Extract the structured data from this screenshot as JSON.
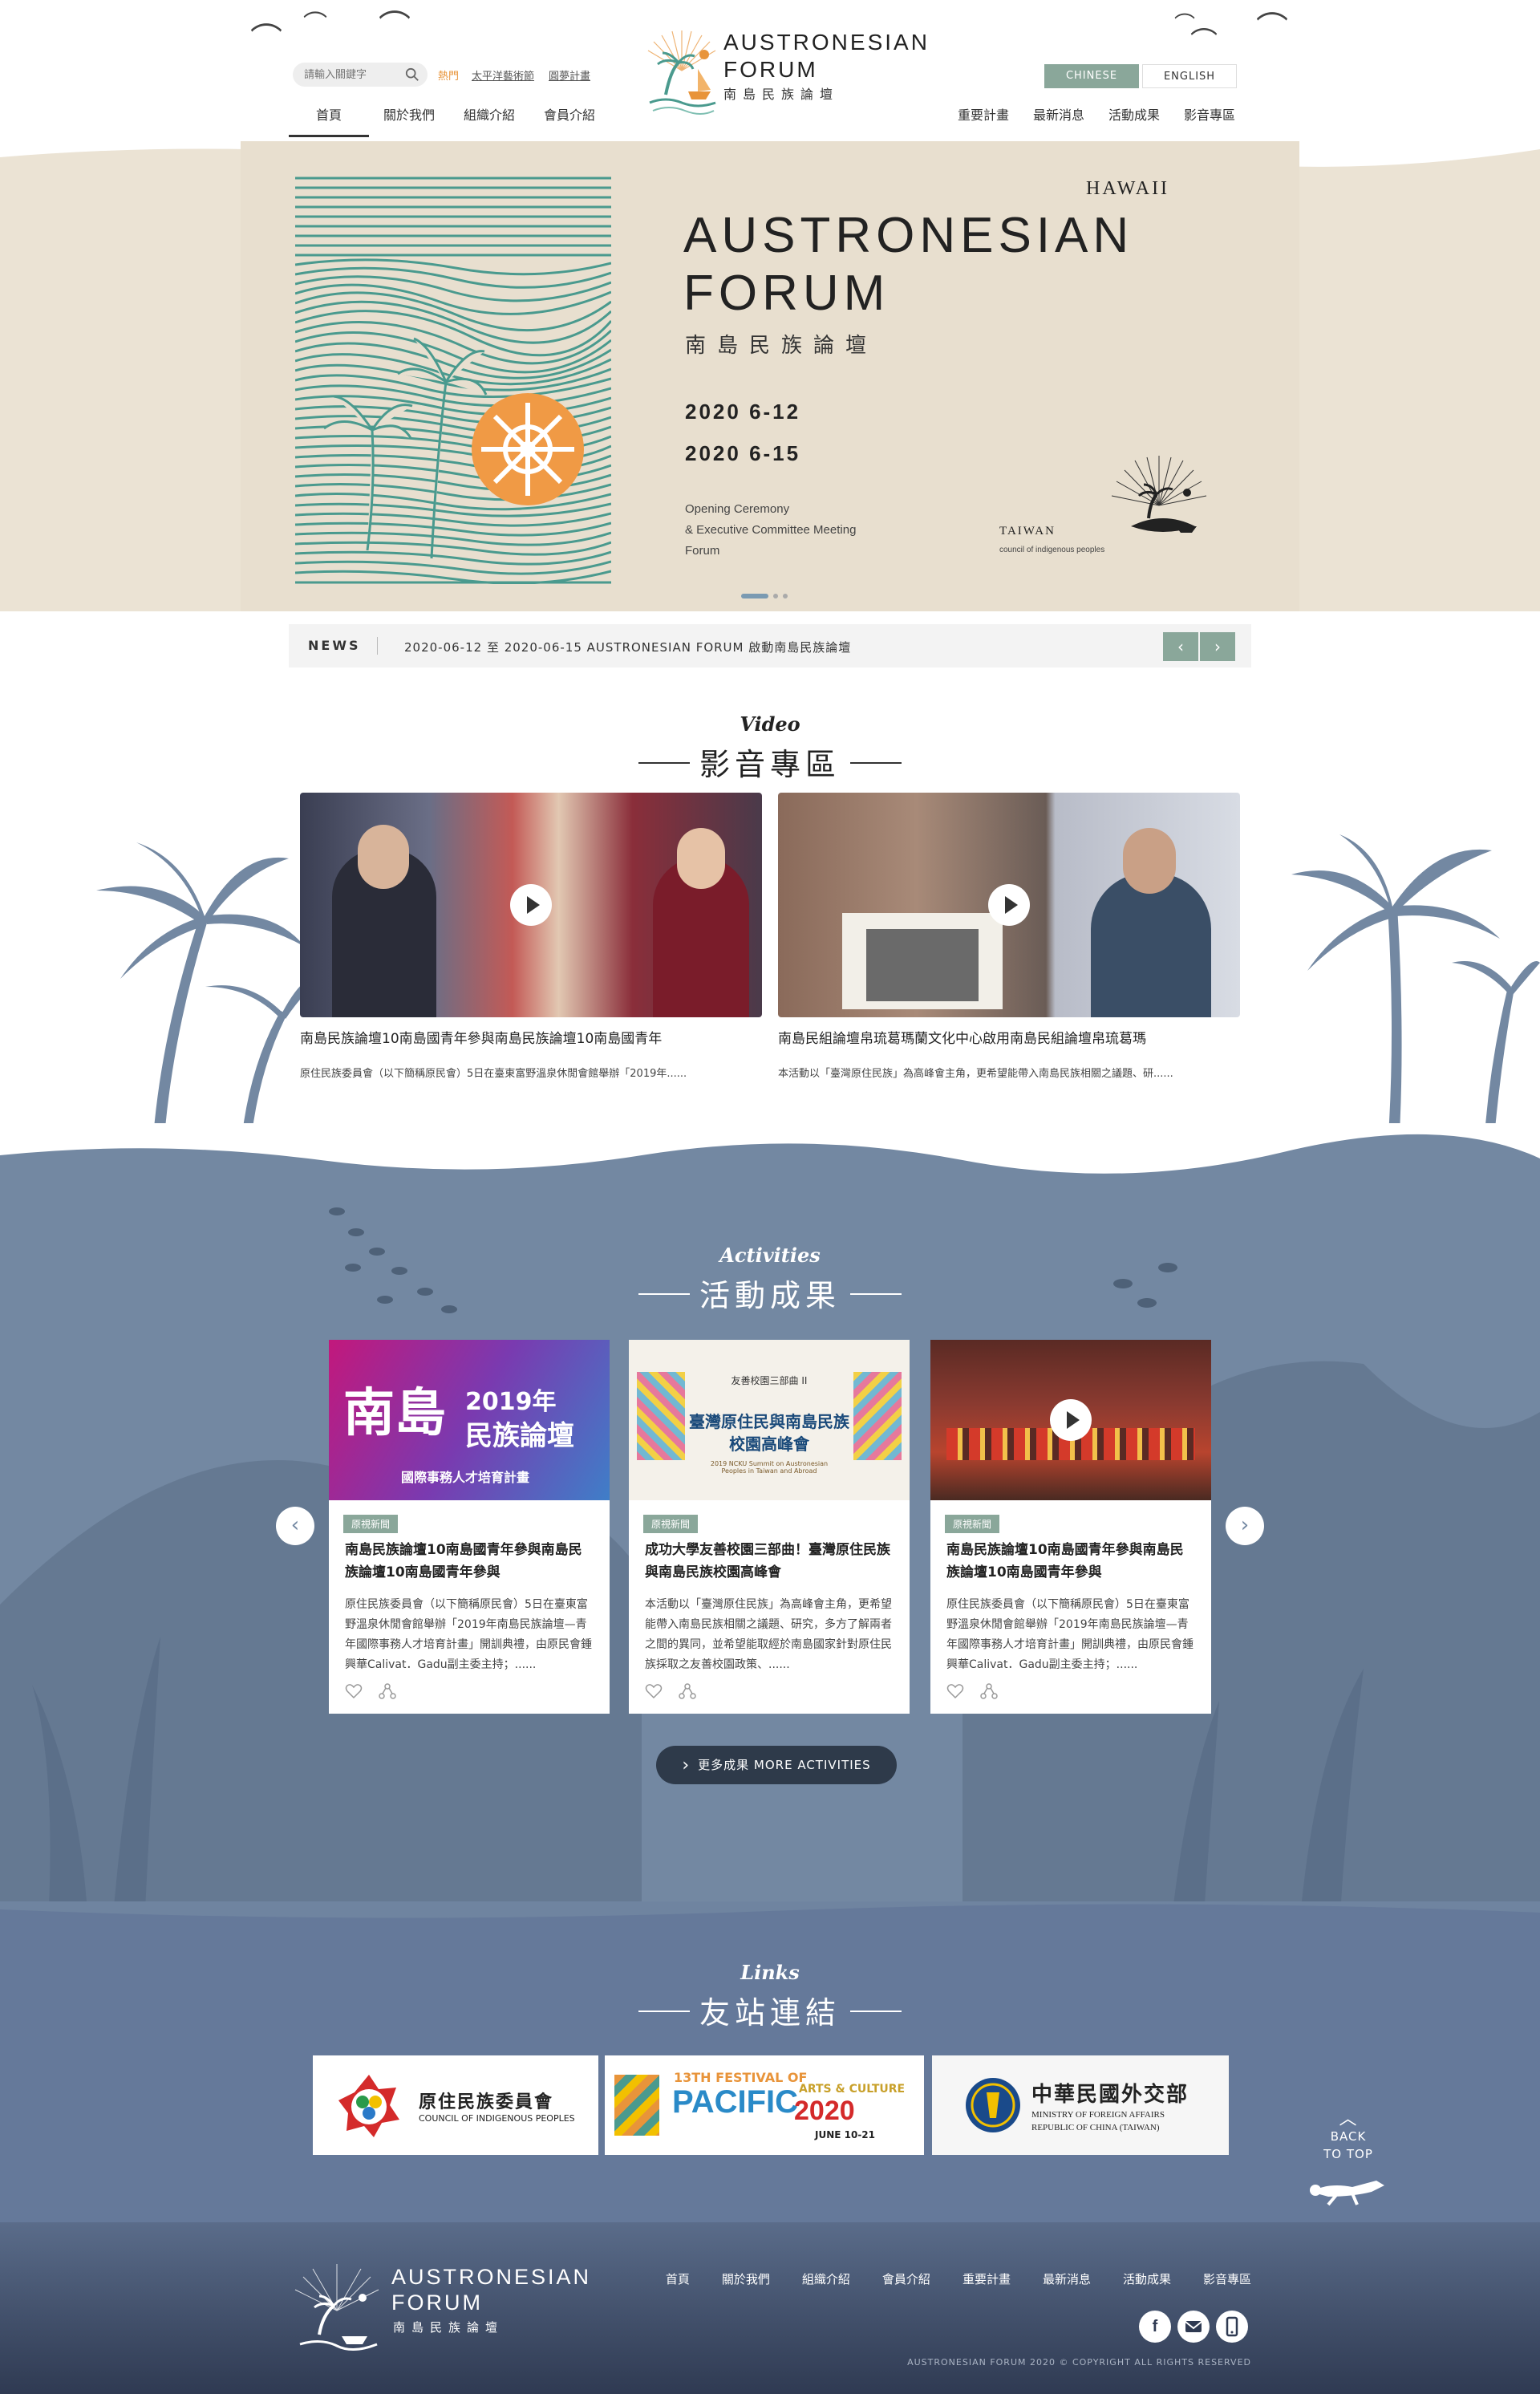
{
  "header": {
    "search_placeholder": "請輸入關鍵字",
    "hot_label": "熱門",
    "hot_links": [
      "太平洋藝術節",
      "圓夢計畫"
    ],
    "nav_left": [
      "首頁",
      "關於我們",
      "組織介紹",
      "會員介紹"
    ],
    "nav_right": [
      "重要計畫",
      "最新消息",
      "活動成果",
      "影音專區"
    ],
    "logo_title_line1": "AUSTRONESIAN",
    "logo_title_line2": "FORUM",
    "logo_sub": "南島民族論壇",
    "lang_chinese": "CHINESE",
    "lang_english": "ENGLISH"
  },
  "banner": {
    "location": "HAWAII",
    "title_line1": "AUSTRONESIAN",
    "title_line2": "FORUM",
    "subtitle": "南島民族論壇",
    "date1": "2020  6-12",
    "date2": "2020  6-15",
    "desc_line1": "Opening Ceremony",
    "desc_line2": "& Executive Committee Meeting",
    "desc_line3": "Forum",
    "taiwan": "TAIWAN",
    "council": "council of indigenous peoples"
  },
  "news": {
    "label": "NEWS",
    "text": "2020-06-12 至 2020-06-15 AUSTRONESIAN FORUM 啟動南島民族論壇",
    "prev": "‹",
    "next": "›"
  },
  "video": {
    "title_en": "Video",
    "title_zh": "影音專區",
    "items": [
      {
        "title": "南島民族論壇10南島國青年參與南島民族論壇10南島國青年",
        "desc": "原住民族委員會（以下簡稱原民會）5日在臺東富野溫泉休閒會館舉辦「2019年......"
      },
      {
        "title": "南島民組論壇帛琉葛瑪蘭文化中心啟用南島民組論壇帛琉葛瑪",
        "desc": "本活動以「臺灣原住民族」為高峰會主角，更希望能帶入南島民族相關之議題、研......"
      }
    ]
  },
  "activities": {
    "title_en": "Activities",
    "title_zh": "活動成果",
    "prev": "‹",
    "next": "›",
    "more_label": "更多成果  MORE ACTIVITIES",
    "items": [
      {
        "tag": "原視新聞",
        "thumb_line1": "南島",
        "thumb_line2": "2019年",
        "thumb_line3": "民族論壇",
        "thumb_line4": "國際事務人才培育計畫",
        "title": "南島民族論壇10南島國青年參與南島民族論壇10南島國青年參與",
        "desc": "原住民族委員會（以下簡稱原民會）5日在臺東富野溫泉休閒會館舉辦「2019年南島民族論壇—青年國際事務人才培育計畫」開訓典禮，由原民會鍾興華Calivat．Gadu副主委主持；......"
      },
      {
        "tag": "原視新聞",
        "thumb_line1": "友善校園三部曲 II",
        "thumb_line2": "臺灣原住民與南島民族",
        "thumb_line3": "校園高峰會",
        "thumb_line4": "2019 NCKU Summit on Austronesian Peoples in Taiwan and Abroad",
        "title": "成功大學友善校園三部曲！臺灣原住民族與南島民族校園高峰會",
        "desc": "本活動以「臺灣原住民族」為高峰會主角，更希望能帶入南島民族相關之議題、研究，多方了解兩者之間的異同，並希望能取經於南島國家針對原住民族採取之友善校園政策、......"
      },
      {
        "tag": "原視新聞",
        "title": "南島民族論壇10南島國青年參與南島民族論壇10南島國青年參與",
        "desc": "原住民族委員會（以下簡稱原民會）5日在臺東富野溫泉休閒會館舉辦「2019年南島民族論壇—青年國際事務人才培育計畫」開訓典禮，由原民會鍾興華Calivat．Gadu副主委主持；......"
      }
    ]
  },
  "links": {
    "title_en": "Links",
    "title_zh": "友站連結",
    "cip_zh": "原住民族委員會",
    "cip_en": "COUNCIL OF INDIGENOUS PEOPLES",
    "festival_line1": "13TH FESTIVAL OF",
    "festival_line2": "PACIFIC",
    "festival_line3": "ARTS & CULTURE",
    "festival_year": "2020",
    "festival_date": "JUNE 10-21",
    "mofa_zh": "中華民國外交部",
    "mofa_en1": "MINISTRY OF FOREIGN AFFAIRS",
    "mofa_en2": "REPUBLIC OF CHINA (TAIWAN)",
    "back_top_line1": "BACK",
    "back_top_line2": "TO TOP"
  },
  "footer": {
    "logo_title_line1": "AUSTRONESIAN",
    "logo_title_line2": "FORUM",
    "logo_sub": "南島民族論壇",
    "nav": [
      "首頁",
      "關於我們",
      "組織介紹",
      "會員介紹",
      "重要計畫",
      "最新消息",
      "活動成果",
      "影音專區"
    ],
    "copyright": "AUSTRONESIAN FORUM 2020 © COPYRIGHT ALL RIGHTS RESERVED"
  },
  "colors": {
    "accent_green": "#8aa79a",
    "banner_bg": "#ebe3d4",
    "ocean_blue": "#7388a2",
    "footer_dark": "#2f3a52",
    "hot_orange": "#e8943a"
  }
}
